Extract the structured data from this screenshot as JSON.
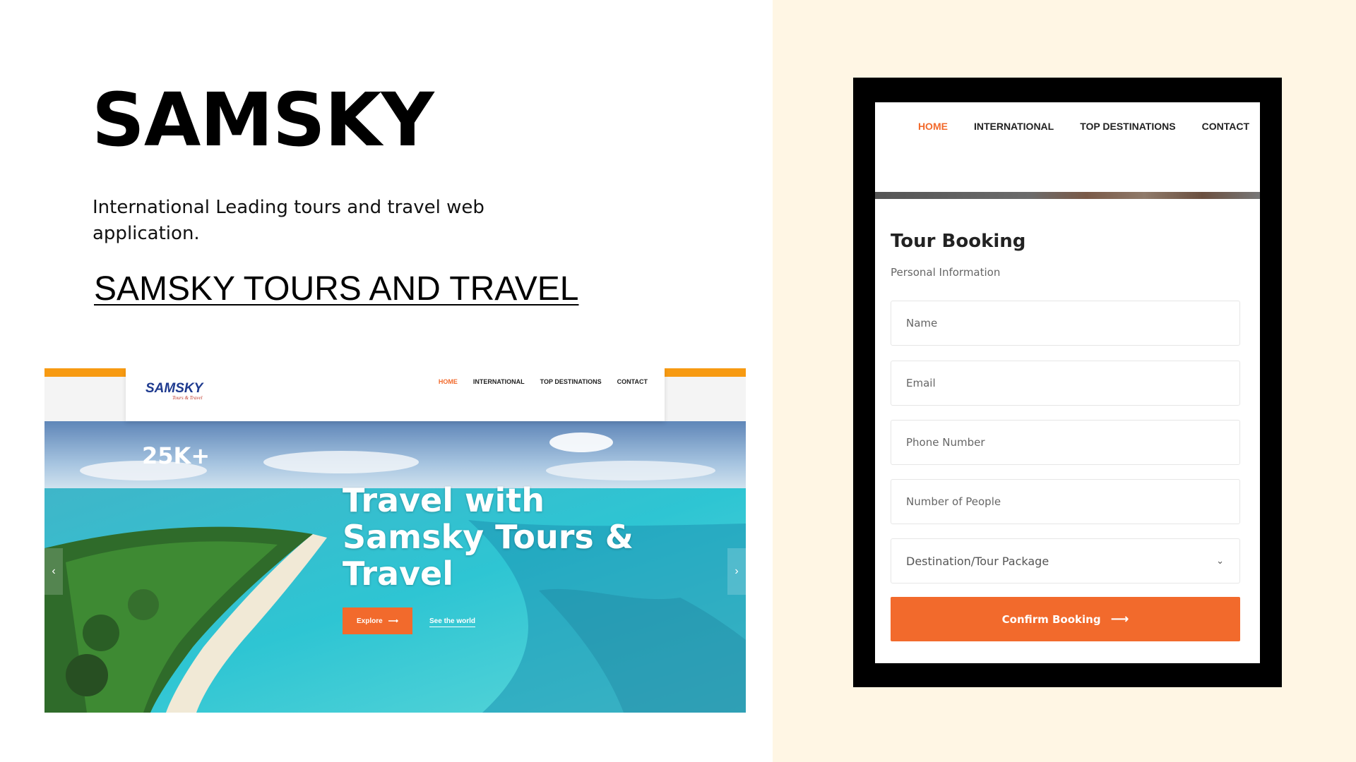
{
  "brand": {
    "title": "SAMSKY",
    "tagline": "International Leading tours and travel web application.",
    "link_text": "SAMSKY TOURS AND TRAVEL"
  },
  "website": {
    "logo_text": "SAMSKY",
    "logo_subtext": "Tours & Travel",
    "nav": [
      "HOME",
      "INTERNATIONAL",
      "TOP DESTINATIONS",
      "CONTACT"
    ],
    "active_nav": "HOME",
    "hero": {
      "stat": "25K+",
      "heading": "Travel with Samsky Tours & Travel",
      "explore_label": "Explore",
      "see_world_label": "See the world",
      "prev_icon": "chevron-left-icon",
      "next_icon": "chevron-right-icon"
    }
  },
  "mobile": {
    "nav": [
      "HOME",
      "INTERNATIONAL",
      "TOP DESTINATIONS",
      "CONTACT"
    ],
    "active_nav": "HOME",
    "form": {
      "title": "Tour Booking",
      "subtitle": "Personal Information",
      "fields": {
        "name": "Name",
        "email": "Email",
        "phone": "Phone Number",
        "people": "Number of People"
      },
      "select_placeholder": "Destination/Tour Package",
      "submit_label": "Confirm Booking"
    }
  },
  "colors": {
    "accent_orange": "#f26a2c",
    "topbar_orange": "#f79a12",
    "right_panel_bg": "#fff6e4",
    "frame_black": "#000000"
  }
}
